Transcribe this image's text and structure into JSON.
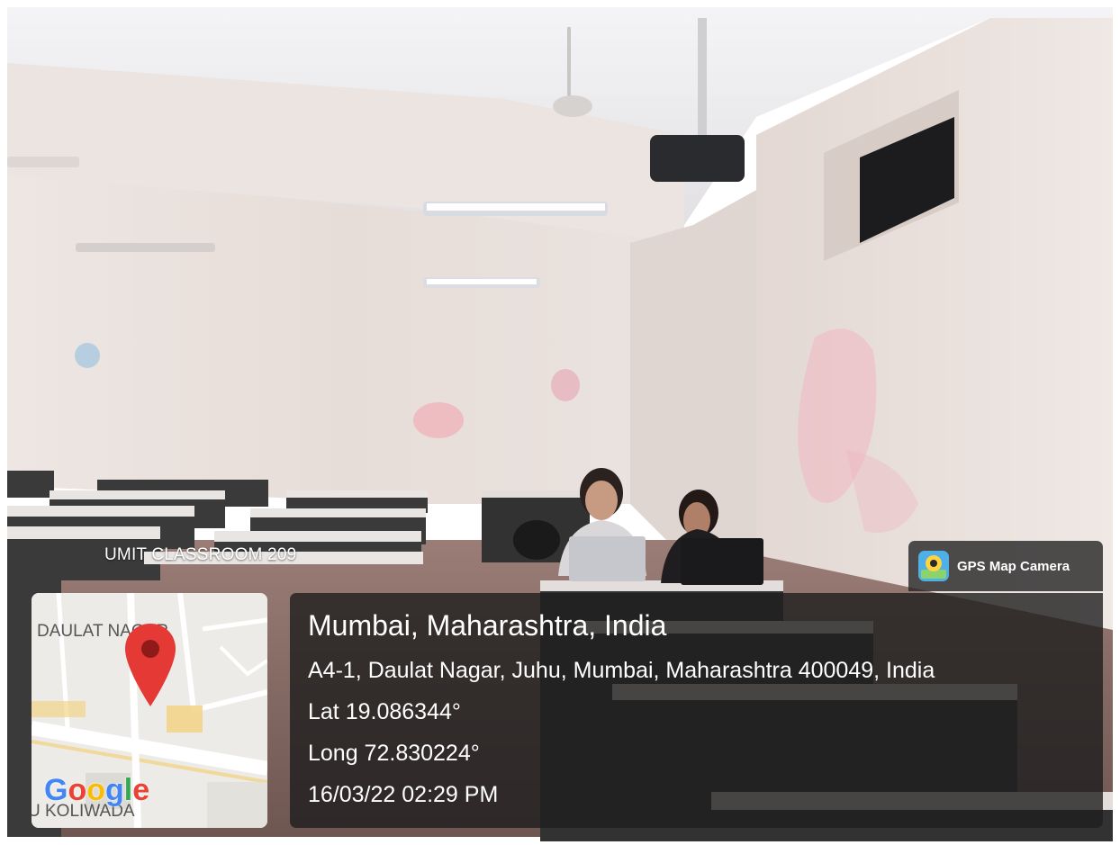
{
  "photo": {
    "scene": "classroom",
    "colors": {
      "wall": "#e9e1dc",
      "ceiling": "#ededee",
      "desk": "#3a3838",
      "floor": "#8e6e66"
    }
  },
  "overlay": {
    "tag": "UMIT CLASSROOM 209",
    "app_name": "GPS Map Camera",
    "app_icon": "gps-map-camera-icon",
    "place": "Mumbai, Maharashtra, India",
    "address": "A4-1, Daulat Nagar, Juhu, Mumbai, Maharashtra 400049, India",
    "latitude": "Lat 19.086344°",
    "longitude": "Long 72.830224°",
    "datetime": "16/03/22 02:29 PM",
    "panel_color": "#1e1e1e"
  },
  "map": {
    "area_label_top": "DAULAT NAGAR",
    "area_label_bottom": "U KOLIWADA",
    "provider": "Google",
    "pin_icon": "map-pin-icon",
    "pin_color": "#e53935"
  }
}
